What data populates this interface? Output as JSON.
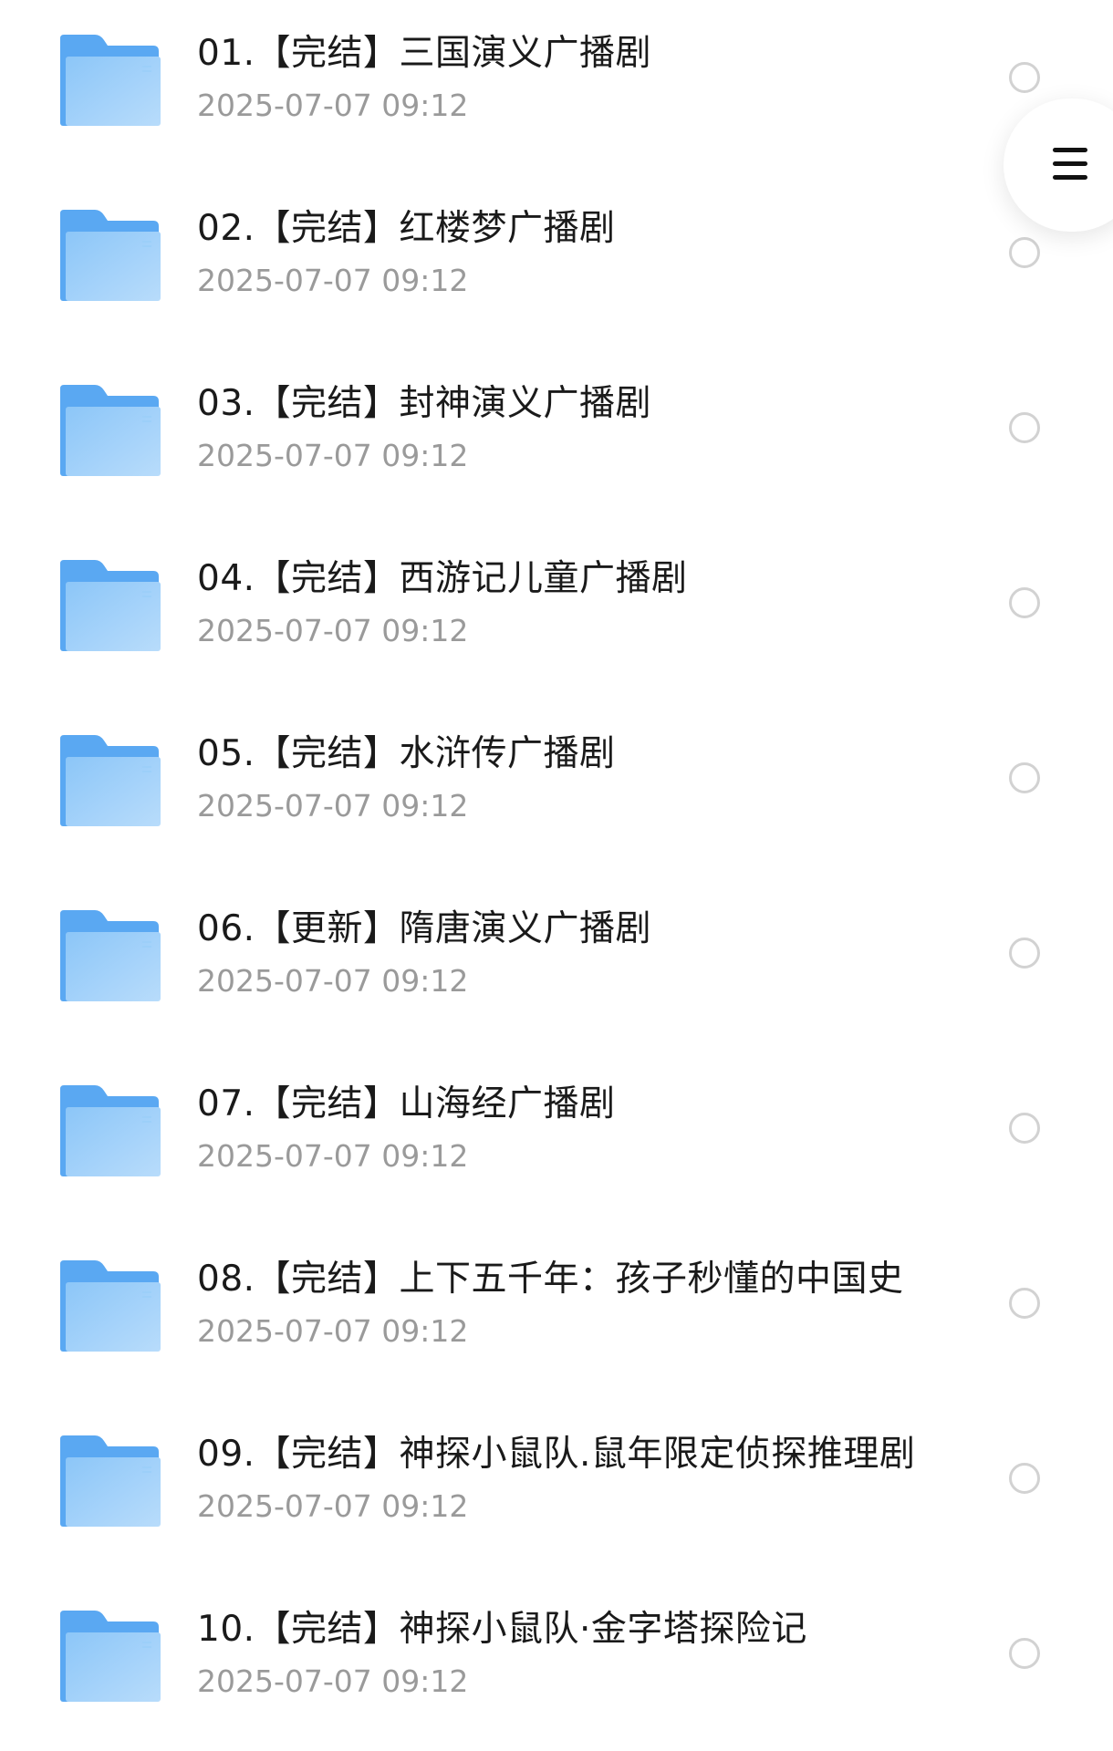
{
  "folders": [
    {
      "name": "01.【完结】三国演义广播剧",
      "date": "2025-07-07 09:12"
    },
    {
      "name": "02.【完结】红楼梦广播剧",
      "date": "2025-07-07 09:12"
    },
    {
      "name": "03.【完结】封神演义广播剧",
      "date": "2025-07-07 09:12"
    },
    {
      "name": "04.【完结】西游记儿童广播剧",
      "date": "2025-07-07 09:12"
    },
    {
      "name": "05.【完结】水浒传广播剧",
      "date": "2025-07-07 09:12"
    },
    {
      "name": "06.【更新】隋唐演义广播剧",
      "date": "2025-07-07 09:12"
    },
    {
      "name": "07.【完结】山海经广播剧",
      "date": "2025-07-07 09:12"
    },
    {
      "name": "08.【完结】上下五千年：孩子秒懂的中国史",
      "date": "2025-07-07 09:12"
    },
    {
      "name": "09.【完结】神探小鼠队.鼠年限定侦探推理剧",
      "date": "2025-07-07 09:12"
    },
    {
      "name": "10.【完结】神探小鼠队·金字塔探险记",
      "date": "2025-07-07 09:12"
    }
  ],
  "icons": {
    "folder": "folder-icon",
    "menu": "menu-icon",
    "select": "radio-circle"
  },
  "colors": {
    "folder_tab": "#5aa8f2",
    "folder_front_top": "#8cc6f8",
    "folder_front_bottom": "#b6dbfb",
    "name_text": "#1a1a1a",
    "date_text": "#9a9a9a",
    "radio_border": "#d2d2d2"
  }
}
